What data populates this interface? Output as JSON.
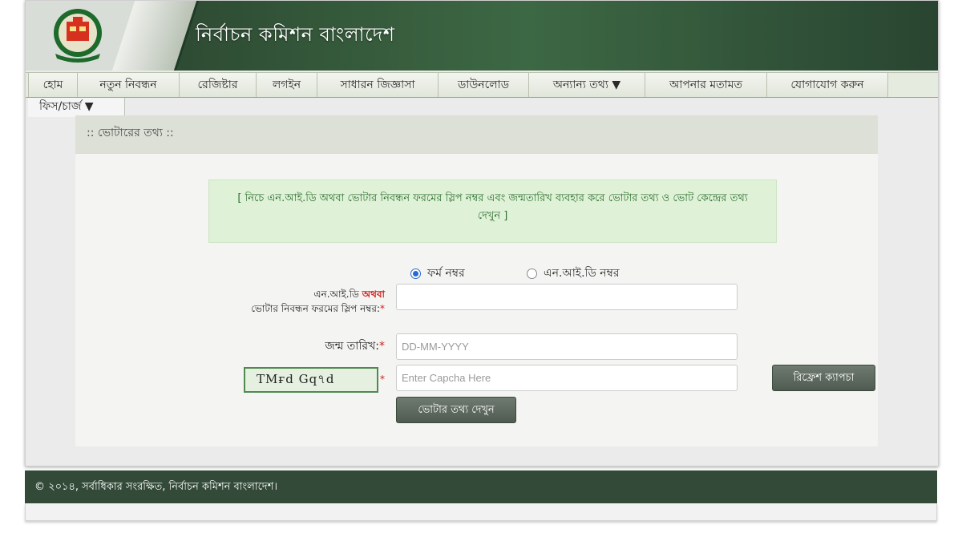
{
  "header": {
    "title": "নির্বাচন কমিশন বাংলাদেশ"
  },
  "nav": {
    "items": [
      {
        "label": "হোম"
      },
      {
        "label": "নতুন নিবন্ধন"
      },
      {
        "label": "রেজিষ্টার"
      },
      {
        "label": "লগইন"
      },
      {
        "label": "সাধারন জিজ্ঞাসা"
      },
      {
        "label": "ডাউনলোড"
      },
      {
        "label": "অন্যান্য তথ্য ▼"
      },
      {
        "label": "আপনার মতামত"
      },
      {
        "label": "যোগাযোগ করুন"
      }
    ],
    "second_row": {
      "label": "ফিস/চার্জ ▼"
    }
  },
  "panel": {
    "title": ":: ভোটারের তথ্য ::",
    "info": "[ নিচে এন.আই.ডি অথবা ভোটার নিবন্ধন ফরমের স্লিপ নম্বর এবং জন্মতারিখ ব্যবহার করে ভোটার তথ্য ও ভোট কেন্দ্রের তথ্য দেখুন ]"
  },
  "form": {
    "radio_form_number": "ফর্ম নম্বর",
    "radio_nid_number": "এন.আই.ডি নম্বর",
    "selected_radio": "form_number",
    "id_label_part1": "এন.আই.ডি",
    "id_label_or": "অথবা",
    "id_label_part2": "ভোটার নিবন্ধন ফরমের স্লিপ নম্বর:",
    "id_value": "",
    "dob_label": "জন্ম তারিখ:",
    "dob_placeholder": "DD-MM-YYYY",
    "dob_value": "",
    "captcha_text": "TMғd Gq৭d",
    "captcha_placeholder": "Enter Capcha Here",
    "captcha_value": "",
    "refresh_button": "রিফ্রেশ ক্যাপচা",
    "submit_button": "ভোটার তথ্য দেখুন",
    "required_marker": "*"
  },
  "footer": {
    "text": "© ২০১৪, সর্বাধিকার সংরক্ষিত, নির্বাচন কমিশন বাংলাদেশ।"
  },
  "colors": {
    "header_green": "#3d6844",
    "footer_green": "#334a38",
    "info_bg": "#dff2d8",
    "required_red": "#d02020"
  }
}
